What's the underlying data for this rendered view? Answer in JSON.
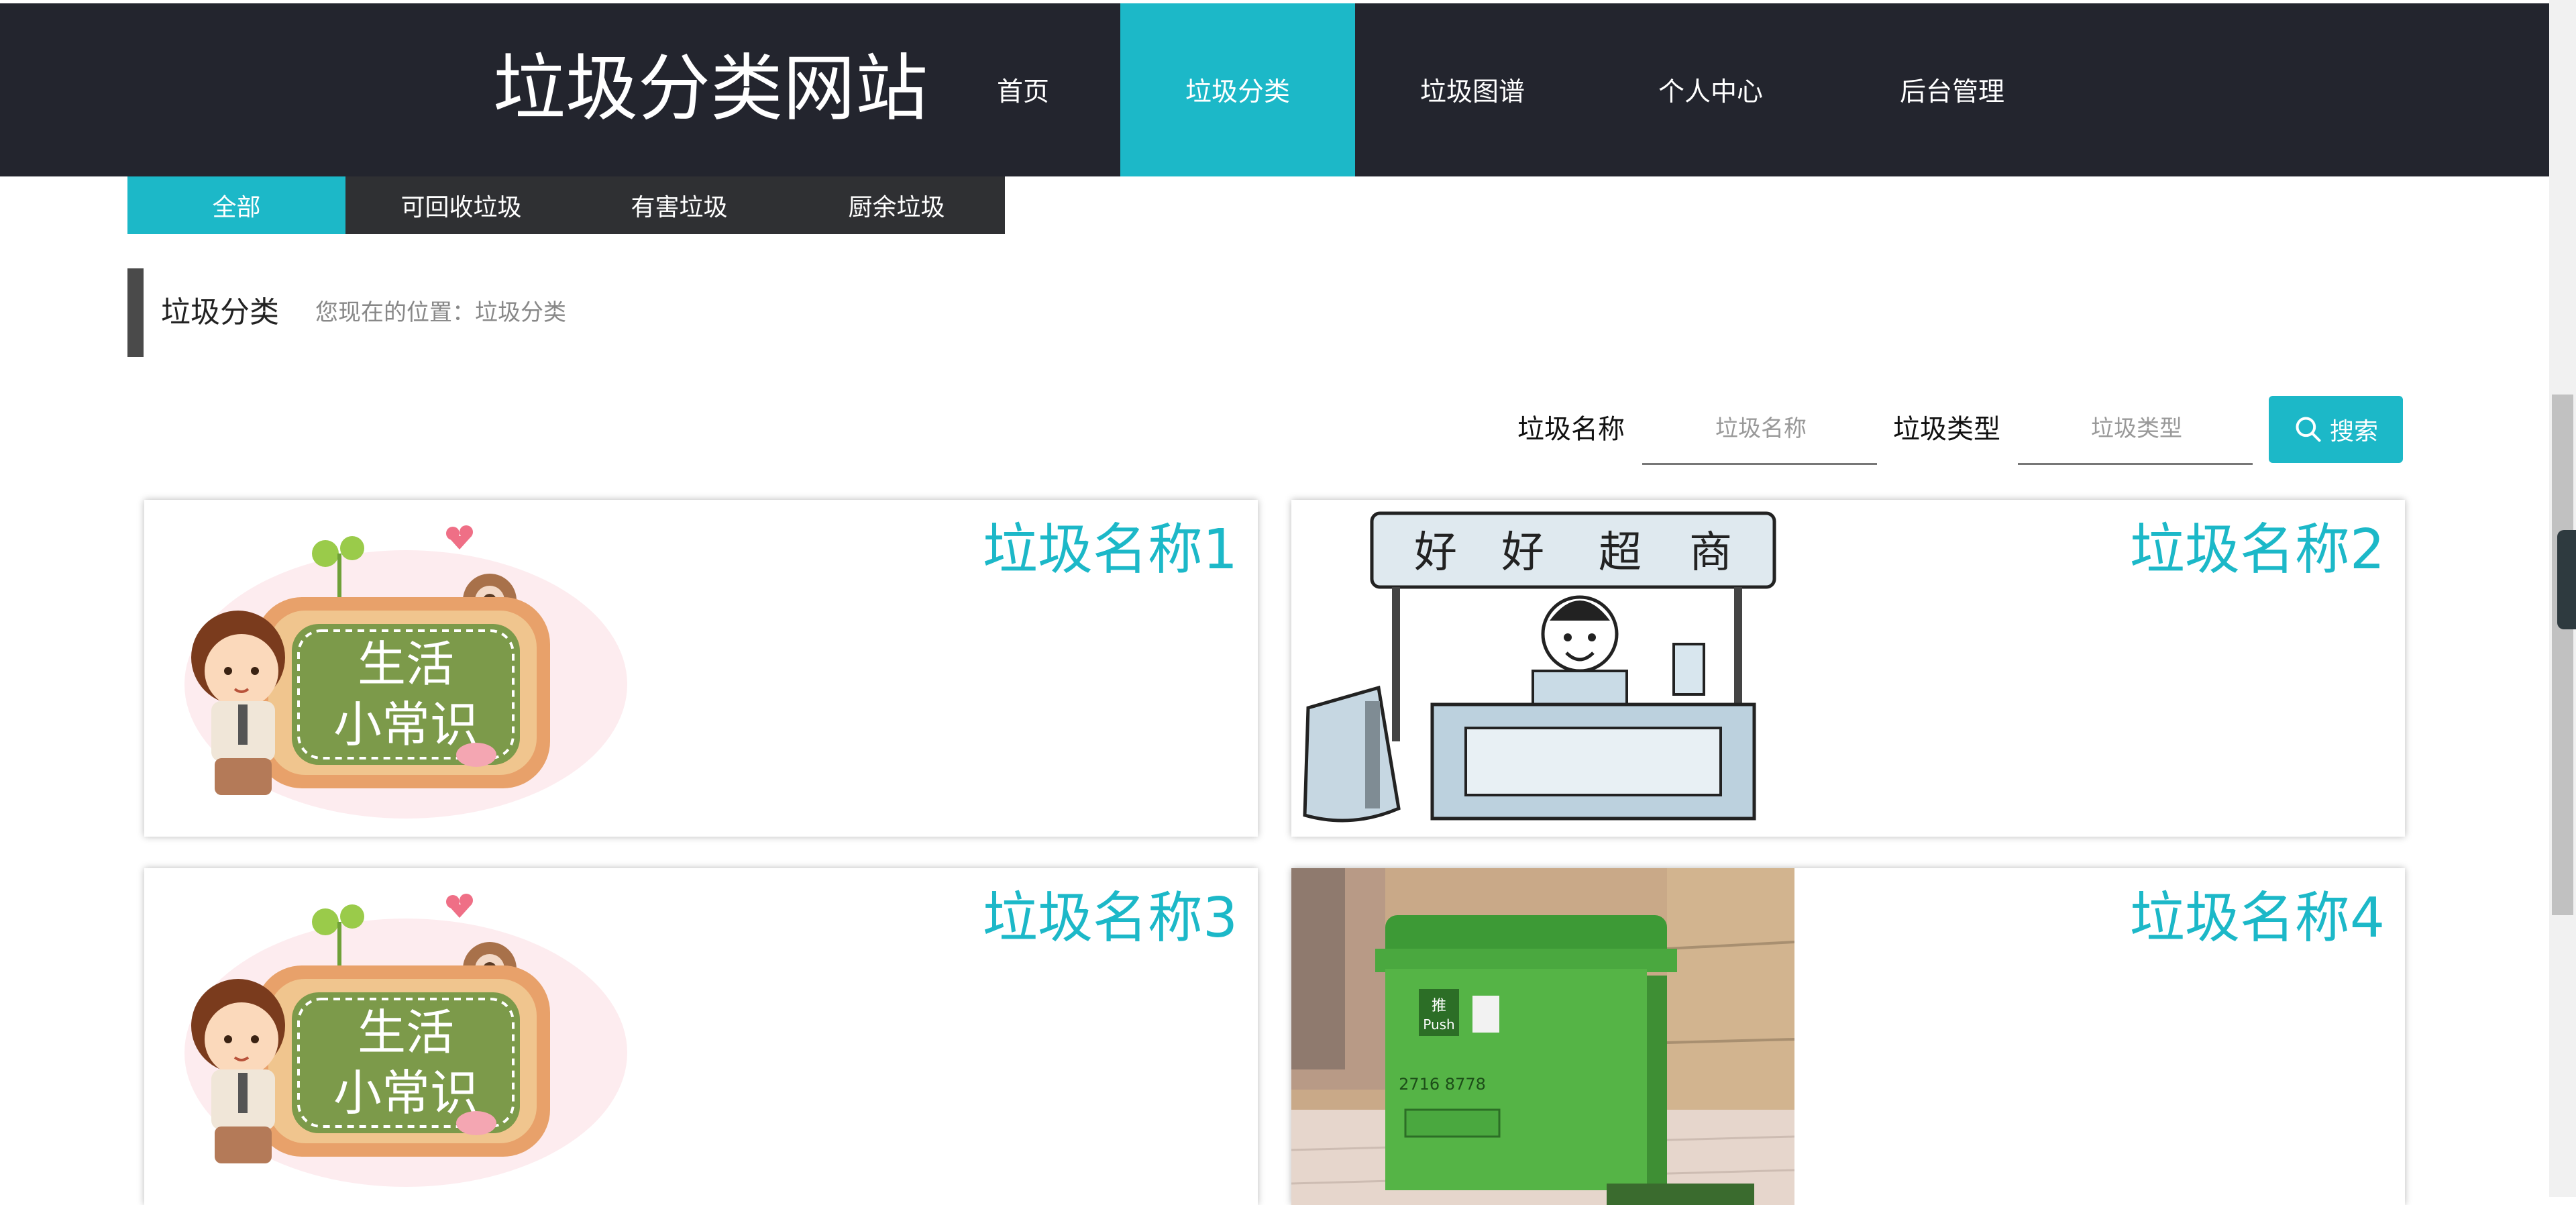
{
  "site": {
    "title": "垃圾分类网站"
  },
  "nav": [
    {
      "label": "首页"
    },
    {
      "label": "垃圾分类",
      "active": true
    },
    {
      "label": "垃圾图谱"
    },
    {
      "label": "个人中心"
    },
    {
      "label": "后台管理"
    }
  ],
  "subnav": [
    {
      "label": "全部",
      "active": true
    },
    {
      "label": "可回收垃圾"
    },
    {
      "label": "有害垃圾"
    },
    {
      "label": "厨余垃圾"
    }
  ],
  "page": {
    "title": "垃圾分类",
    "breadcrumb": "您现在的位置：垃圾分类"
  },
  "search": {
    "name_label": "垃圾名称",
    "name_placeholder": "垃圾名称",
    "type_label": "垃圾类型",
    "type_placeholder": "垃圾类型",
    "button_label": "搜索"
  },
  "cards": [
    {
      "name": "垃圾名称1",
      "image": "生活小常识",
      "image_lines": [
        "生活",
        "小常识"
      ]
    },
    {
      "name": "垃圾名称2",
      "image": "好好超商",
      "image_chars": [
        "好",
        "好",
        "超",
        "商"
      ]
    },
    {
      "name": "垃圾名称3",
      "image": "生活小常识",
      "image_lines": [
        "生活",
        "小常识"
      ]
    },
    {
      "name": "垃圾名称4",
      "image": "回收箱",
      "bin_text": [
        "推",
        "Push",
        "2716 8778"
      ]
    }
  ],
  "colors": {
    "accent": "#1cb8c8",
    "header_bg": "#23252e",
    "subnav_bg": "#2f3033"
  }
}
